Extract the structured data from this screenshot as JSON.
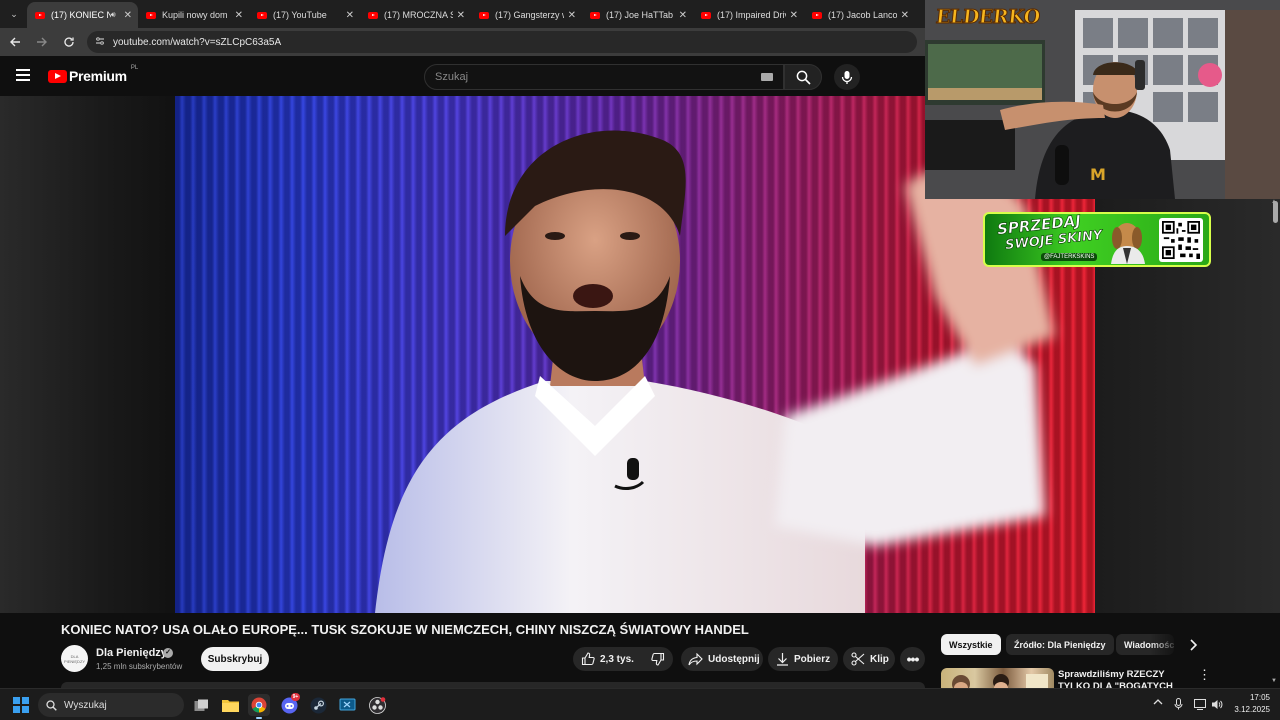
{
  "browser": {
    "tabs": [
      {
        "title": "(17) KONIEC N",
        "active": true,
        "audio": true
      },
      {
        "title": "Kupili nowy dom",
        "active": false
      },
      {
        "title": "(17) YouTube",
        "active": false
      },
      {
        "title": "(17) MROCZNA S",
        "active": false
      },
      {
        "title": "(17) Gangsterzy w",
        "active": false
      },
      {
        "title": "(17) Joe HaTTab",
        "active": false
      },
      {
        "title": "(17) Impaired Driv",
        "active": false
      },
      {
        "title": "(17) Jacob Lanco",
        "active": false
      }
    ],
    "url": "youtube.com/watch?v=sZLCpC63a5A"
  },
  "youtube": {
    "logo_text": "Premium",
    "country_code": "PL",
    "search_placeholder": "Szukaj"
  },
  "stream_overlay": {
    "streamer_logo": "ELDERKO",
    "banner": {
      "line1": "SPRZEDAJ",
      "line2": "SWOJE SKINY",
      "handle": "@FAJTERKSKINS"
    }
  },
  "video": {
    "title": "KONIEC NATO? USA OLAŁO EUROPĘ... TUSK SZOKUJE W NIEMCZECH, CHINY NISZCZĄ ŚWIATOWY HANDEL",
    "channel": {
      "name": "Dla Pieniędzy",
      "subscribers": "1,25 mln subskrybentów",
      "avatar_text": "DLA PIENIĘDZY"
    },
    "subscribe_label": "Subskrybuj",
    "actions": {
      "likes": "2,3 tys.",
      "share": "Udostępnij",
      "download": "Pobierz",
      "clip": "Klip",
      "more": "•••"
    }
  },
  "sidebar": {
    "chips": [
      "Wszystkie",
      "Źródło: Dla Pieniędzy",
      "Wiadomości"
    ],
    "recommended": [
      {
        "title": "Sprawdziliśmy RZECZY TYLKO DLA \"BOGATYCH LUDZI\""
      }
    ]
  },
  "taskbar": {
    "search_placeholder": "Wyszukaj",
    "time": "17:05",
    "date": "3.12.2025",
    "notification_badge": "9+"
  },
  "colors": {
    "youtube_red": "#ff0000",
    "yt_background": "#0f0f0f",
    "banner_green": "#3fcf22",
    "logo_gold": "#f6b51e"
  }
}
